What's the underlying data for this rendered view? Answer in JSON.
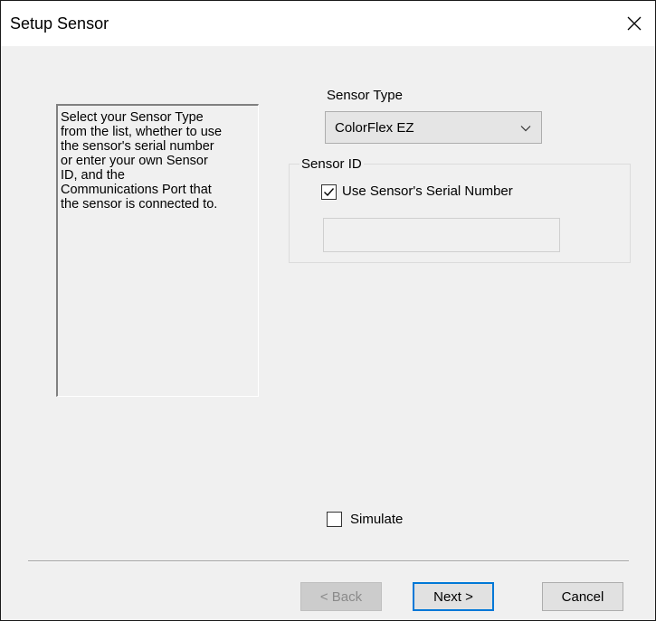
{
  "window": {
    "title": "Setup Sensor"
  },
  "info": {
    "text": "Select your Sensor Type\nfrom the list, whether to use\nthe sensor's serial number\nor enter your own Sensor\nID, and the\nCommunications Port that\nthe sensor is connected to."
  },
  "sensor_type": {
    "label": "Sensor Type",
    "selected": "ColorFlex EZ"
  },
  "sensor_id": {
    "group_label": "Sensor ID",
    "use_serial_label": "Use Sensor's Serial Number",
    "use_serial_checked": true,
    "id_value": ""
  },
  "simulate": {
    "label": "Simulate",
    "checked": false
  },
  "buttons": {
    "back": "< Back",
    "next": "Next >",
    "cancel": "Cancel"
  },
  "icons": {
    "close": "close-icon",
    "dropdown": "chevron-down-icon",
    "check": "checkmark-icon"
  }
}
